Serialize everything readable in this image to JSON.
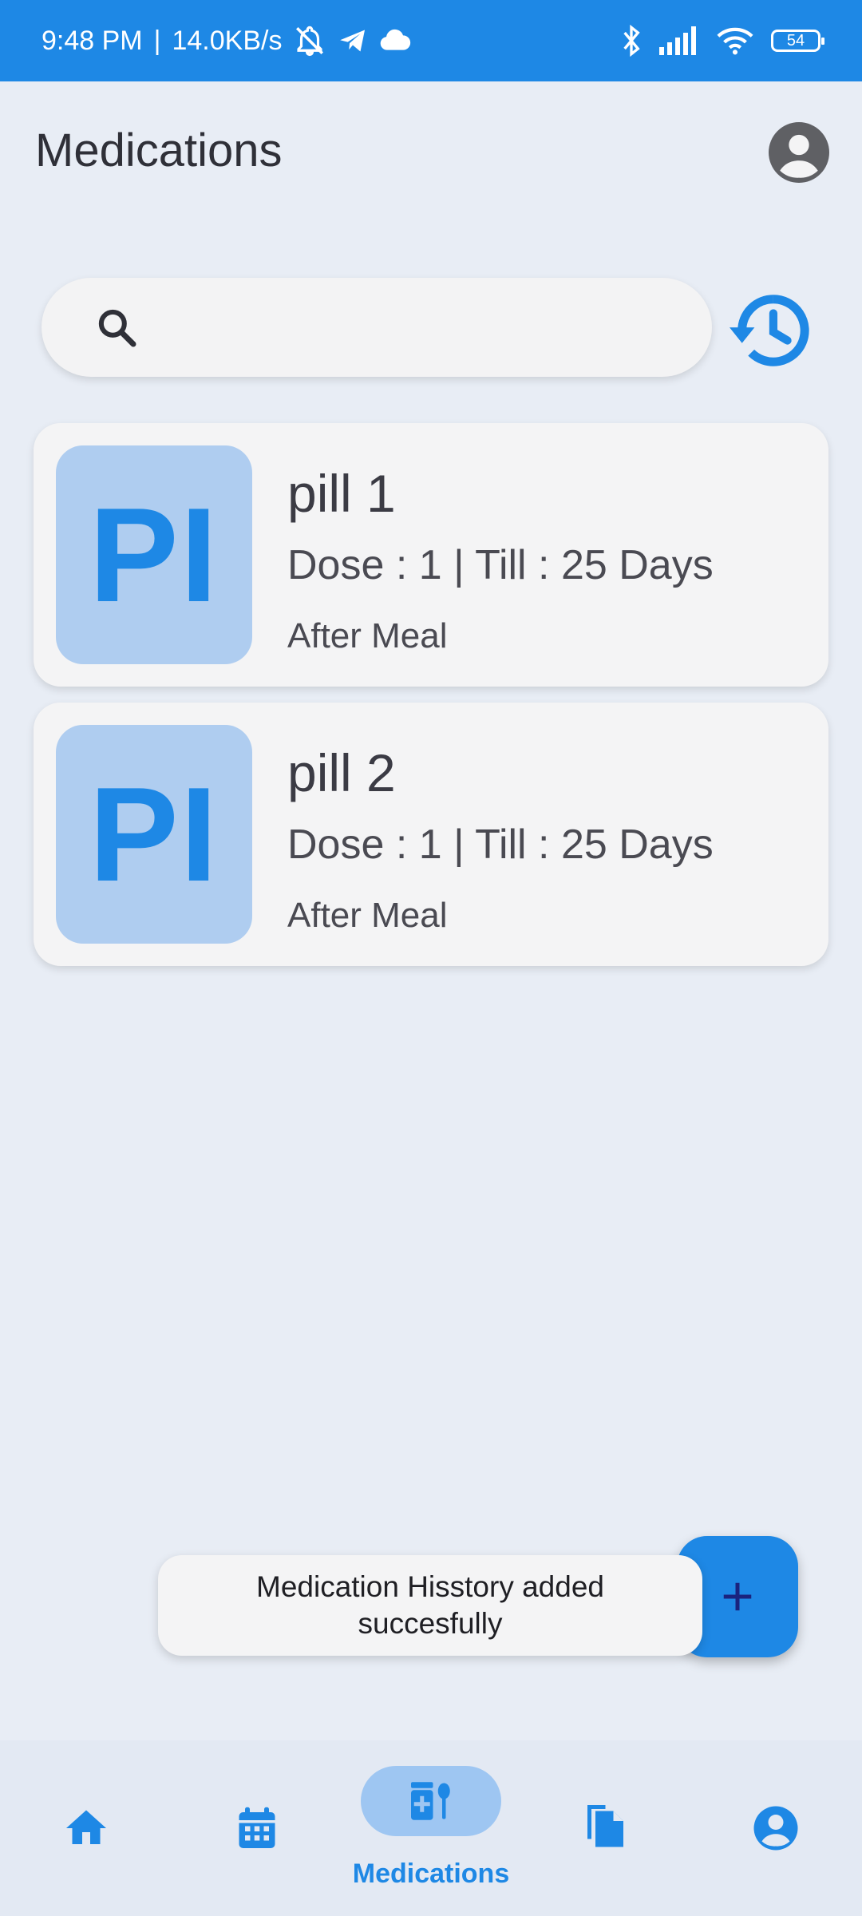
{
  "status_bar": {
    "time": "9:48 PM",
    "separator": "|",
    "network_speed": "14.0KB/s",
    "battery": "54",
    "icons": [
      "muted-bell-icon",
      "telegram-icon",
      "cloud-icon",
      "bluetooth-icon",
      "signal-icon",
      "wifi-icon",
      "battery-icon"
    ]
  },
  "header": {
    "title": "Medications",
    "profile_icon": "account-circle-icon"
  },
  "search": {
    "placeholder": "",
    "value": "",
    "icon": "search-icon",
    "history_icon": "history-icon"
  },
  "medications": [
    {
      "avatar": "PI",
      "name": "pill 1",
      "dose_line": "Dose : 1 | Till : 25 Days",
      "timing": "After Meal"
    },
    {
      "avatar": "PI",
      "name": "pill 2",
      "dose_line": "Dose : 1 | Till : 25 Days",
      "timing": "After Meal"
    }
  ],
  "snackbar": {
    "message": "Medication Hisstory added succesfully"
  },
  "fab": {
    "label": "+"
  },
  "bottom_nav": {
    "active": "Medications",
    "items": [
      {
        "icon": "home-icon"
      },
      {
        "icon": "calendar-icon"
      },
      {
        "icon": "medications-icon",
        "label": "Medications"
      },
      {
        "icon": "documents-icon"
      },
      {
        "icon": "account-circle-icon"
      }
    ]
  },
  "colors": {
    "accent": "#1e88e5",
    "background": "#e8edf5",
    "card": "#f4f4f5",
    "avatar_bg": "#afcdf0",
    "nav_active_bg": "#9ec6f2",
    "fab_plus": "#1a237e"
  }
}
